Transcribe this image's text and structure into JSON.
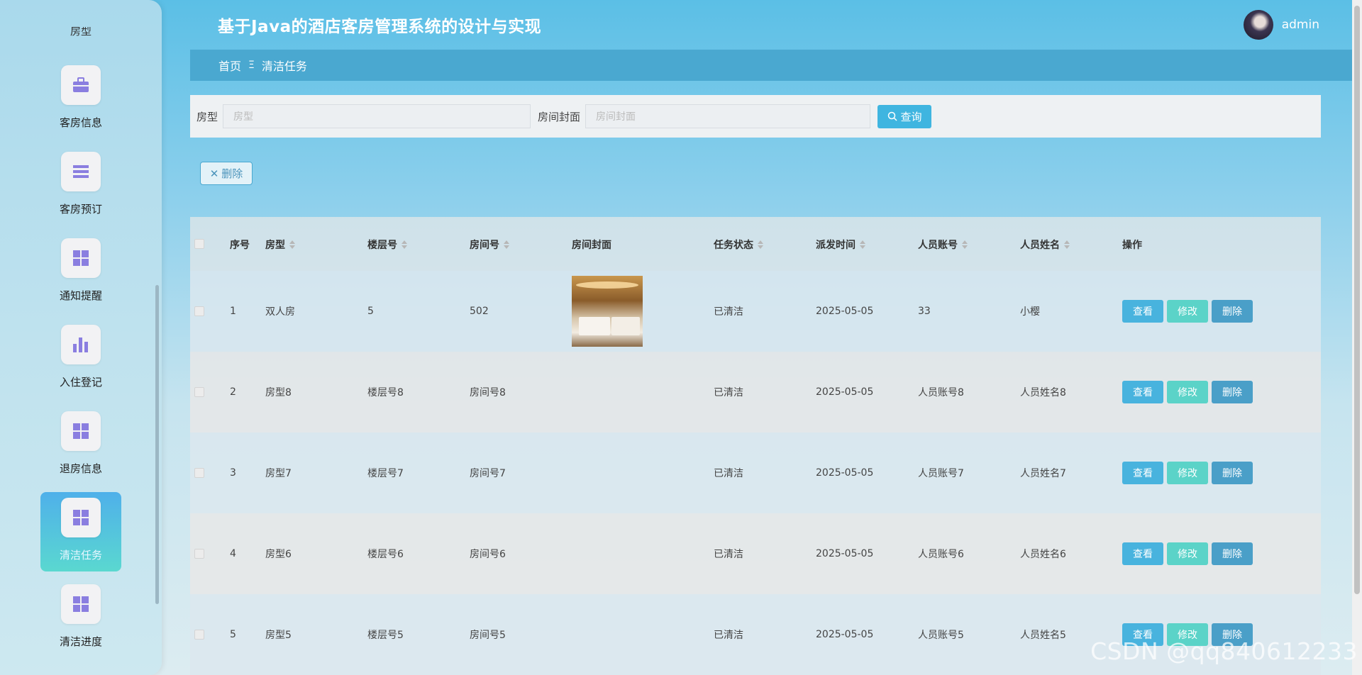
{
  "header": {
    "title": "基于Java的酒店客房管理系统的设计与实现",
    "username": "admin"
  },
  "breadcrumb": {
    "home": "首页",
    "separator": "Ξ",
    "current": "清洁任务"
  },
  "sidebar": {
    "partial_label": "房型",
    "items": [
      {
        "label": "客房信息",
        "icon": "briefcase-icon"
      },
      {
        "label": "客房预订",
        "icon": "list-icon"
      },
      {
        "label": "通知提醒",
        "icon": "grid-icon"
      },
      {
        "label": "入住登记",
        "icon": "bar-chart-icon"
      },
      {
        "label": "退房信息",
        "icon": "grid-icon"
      },
      {
        "label": "清洁任务",
        "icon": "grid-icon",
        "active": true
      },
      {
        "label": "清洁进度",
        "icon": "grid-icon"
      }
    ]
  },
  "search": {
    "room_type_label": "房型",
    "room_type_placeholder": "房型",
    "cover_label": "房间封面",
    "cover_placeholder": "房间封面",
    "search_button": "查询"
  },
  "toolbar": {
    "delete_label": "删除"
  },
  "table": {
    "columns": [
      "序号",
      "房型",
      "楼层号",
      "房间号",
      "房间封面",
      "任务状态",
      "派发时间",
      "人员账号",
      "人员姓名",
      "操作"
    ],
    "rows": [
      {
        "no": "1",
        "room_type": "双人房",
        "floor": "5",
        "room_no": "502",
        "has_cover": true,
        "status": "已清洁",
        "time": "2025-05-05",
        "account": "33",
        "name": "小樱"
      },
      {
        "no": "2",
        "room_type": "房型8",
        "floor": "楼层号8",
        "room_no": "房间号8",
        "has_cover": false,
        "status": "已清洁",
        "time": "2025-05-05",
        "account": "人员账号8",
        "name": "人员姓名8"
      },
      {
        "no": "3",
        "room_type": "房型7",
        "floor": "楼层号7",
        "room_no": "房间号7",
        "has_cover": false,
        "status": "已清洁",
        "time": "2025-05-05",
        "account": "人员账号7",
        "name": "人员姓名7"
      },
      {
        "no": "4",
        "room_type": "房型6",
        "floor": "楼层号6",
        "room_no": "房间号6",
        "has_cover": false,
        "status": "已清洁",
        "time": "2025-05-05",
        "account": "人员账号6",
        "name": "人员姓名6"
      },
      {
        "no": "5",
        "room_type": "房型5",
        "floor": "楼层号5",
        "room_no": "房间号5",
        "has_cover": false,
        "status": "已清洁",
        "time": "2025-05-05",
        "account": "人员账号5",
        "name": "人员姓名5"
      }
    ],
    "actions": {
      "view": "查看",
      "edit": "修改",
      "delete": "删除"
    }
  },
  "watermark": "CSDN @qq840612233",
  "colors": {
    "accent": "#3fb5e0",
    "edit": "#5bd3c8",
    "delete": "#4a9fc8",
    "sidebar_active": "#4fb0ea"
  }
}
